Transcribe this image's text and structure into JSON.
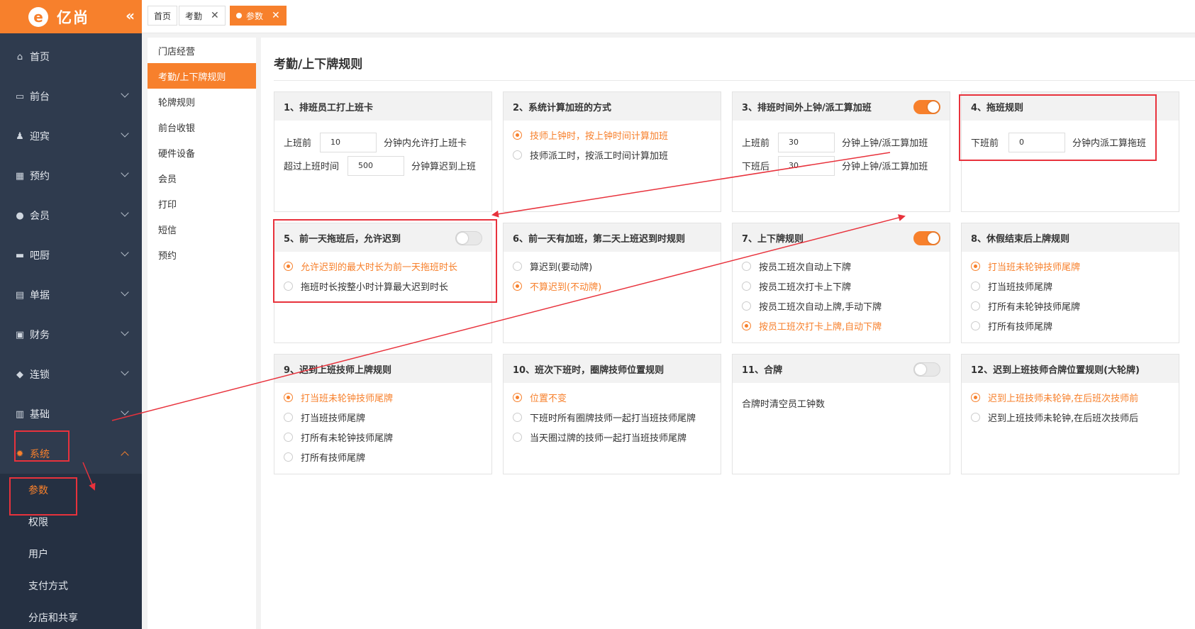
{
  "app": {
    "logo_mark": "e",
    "logo_text": "亿尚"
  },
  "sidebar": {
    "items": [
      {
        "label": "首页",
        "icon": "home-icon",
        "glyph": "⌂"
      },
      {
        "label": "前台",
        "icon": "monitor-icon",
        "glyph": "▭"
      },
      {
        "label": "迎宾",
        "icon": "user-reception-icon",
        "glyph": "♟"
      },
      {
        "label": "预约",
        "icon": "calendar-icon",
        "glyph": "▦"
      },
      {
        "label": "会员",
        "icon": "user-icon",
        "glyph": "●"
      },
      {
        "label": "吧厨",
        "icon": "cup-icon",
        "glyph": "▬"
      },
      {
        "label": "单据",
        "icon": "document-icon",
        "glyph": "▤"
      },
      {
        "label": "财务",
        "icon": "money-icon",
        "glyph": "▣"
      },
      {
        "label": "连锁",
        "icon": "cube-icon",
        "glyph": "◆"
      },
      {
        "label": "基础",
        "icon": "server-icon",
        "glyph": "▥"
      },
      {
        "label": "系统",
        "icon": "gear-icon",
        "glyph": "✹"
      }
    ],
    "sub_items": [
      "参数",
      "权限",
      "用户",
      "支付方式",
      "分店和共享"
    ]
  },
  "tabs": [
    {
      "label": "首页"
    },
    {
      "label": "考勤"
    },
    {
      "label": "参数"
    }
  ],
  "submenu2": [
    "门店经营",
    "考勤/上下牌规则",
    "轮牌规则",
    "前台收银",
    "硬件设备",
    "会员",
    "打印",
    "短信",
    "预约"
  ],
  "page": {
    "title": "考勤/上下牌规则"
  },
  "cards": {
    "c1": {
      "title": "1、排班员工打上班卡",
      "r1_label": "上班前",
      "r1_value": "10",
      "r1_suffix": "分钟内允许打上班卡",
      "r2_label": "超过上班时间",
      "r2_value": "500",
      "r2_suffix": "分钟算迟到上班"
    },
    "c2": {
      "title": "2、系统计算加班的方式",
      "opt1": "技师上钟时，按上钟时间计算加班",
      "opt2": "技师派工时，按派工时间计算加班"
    },
    "c3": {
      "title": "3、排班时间外上钟/派工算加班",
      "r1_label": "上班前",
      "r1_value": "30",
      "r1_suffix": "分钟上钟/派工算加班",
      "r2_label": "下班后",
      "r2_value": "30",
      "r2_suffix": "分钟上钟/派工算加班"
    },
    "c4": {
      "title": "4、拖班规则",
      "r1_label": "下班前",
      "r1_value": "0",
      "r1_suffix": "分钟内派工算拖班"
    },
    "c5": {
      "title": "5、前一天拖班后，允许迟到",
      "opt1": "允许迟到的最大时长为前一天拖班时长",
      "opt2": "拖班时长按整小时计算最大迟到时长"
    },
    "c6": {
      "title": "6、前一天有加班，第二天上班迟到时规则",
      "opt1": "算迟到(要动牌)",
      "opt2": "不算迟到(不动牌)"
    },
    "c7": {
      "title": "7、上下牌规则",
      "opt1": "按员工班次自动上下牌",
      "opt2": "按员工班次打卡上下牌",
      "opt3": "按员工班次自动上牌,手动下牌",
      "opt4": "按员工班次打卡上牌,自动下牌"
    },
    "c8": {
      "title": "8、休假结束后上牌规则",
      "opt1": "打当班未轮钟技师尾牌",
      "opt2": "打当班技师尾牌",
      "opt3": "打所有未轮钟技师尾牌",
      "opt4": "打所有技师尾牌"
    },
    "c9": {
      "title": "9、迟到上班技师上牌规则",
      "opt1": "打当班未轮钟技师尾牌",
      "opt2": "打当班技师尾牌",
      "opt3": "打所有未轮钟技师尾牌",
      "opt4": "打所有技师尾牌"
    },
    "c10": {
      "title": "10、班次下班时，圈牌技师位置规则",
      "opt1": "位置不变",
      "opt2": "下班时所有圈牌技师一起打当班技师尾牌",
      "opt3": "当天圈过牌的技师一起打当班技师尾牌"
    },
    "c11": {
      "title": "11、合牌",
      "text": "合牌时清空员工钟数"
    },
    "c12": {
      "title": "12、迟到上班技师合牌位置规则(大轮牌)",
      "opt1": "迟到上班技师未轮钟,在后班次技师前",
      "opt2": "迟到上班技师未轮钟,在后班次技师后"
    }
  },
  "colors": {
    "accent": "#f7802c",
    "sidebar": "#2f3b4e",
    "annotation": "#e8323c"
  }
}
